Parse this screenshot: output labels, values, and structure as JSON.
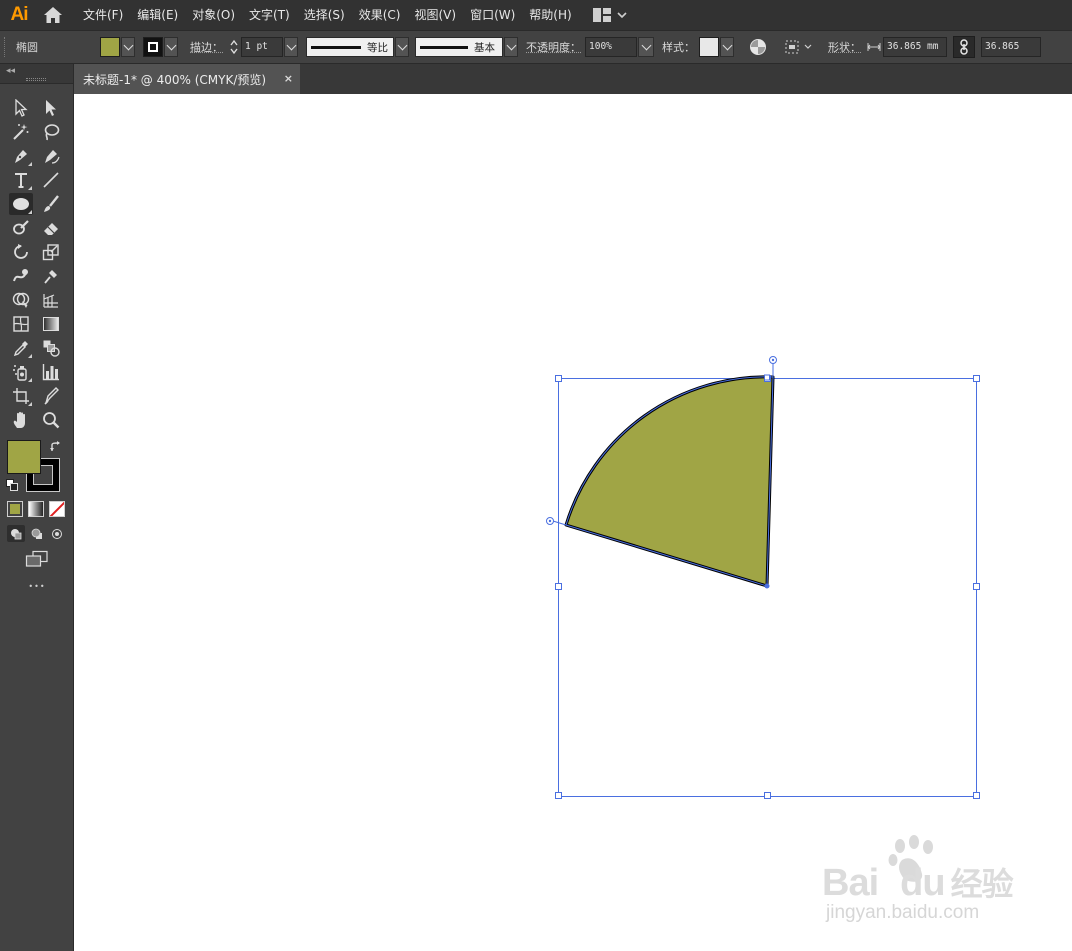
{
  "app": {
    "logo": "Ai",
    "home_icon": "home-icon"
  },
  "menu": {
    "items": [
      "文件(F)",
      "编辑(E)",
      "对象(O)",
      "文字(T)",
      "选择(S)",
      "效果(C)",
      "视图(V)",
      "窗口(W)",
      "帮助(H)"
    ],
    "workspace_icon": "workspace-layout-icon"
  },
  "control_bar": {
    "selection_type": "椭圆",
    "fill_color": "#a0a545",
    "stroke_label": "描边：",
    "stroke_weight": "1 pt",
    "stroke_profile": "等比",
    "brush_definition": "基本",
    "opacity_label": "不透明度：",
    "opacity_value": "100%",
    "style_label": "样式：",
    "shape_label": "形状：",
    "width_value": "36.865 mm",
    "height_value": "36.865"
  },
  "document": {
    "tab_title": "未标题-1* @ 400% (CMYK/预览)",
    "close_glyph": "×"
  },
  "tools": {
    "fill_color": "#a0a545",
    "stroke_color": "#000000",
    "more_glyph": "•••"
  },
  "artwork": {
    "shape": "pie wedge",
    "fill": "#a0a545",
    "stroke": "#000000",
    "selection_color": "#4a6fe0"
  },
  "watermark": {
    "logo": "Bai du 经验",
    "url": "jingyan.baidu.com"
  }
}
